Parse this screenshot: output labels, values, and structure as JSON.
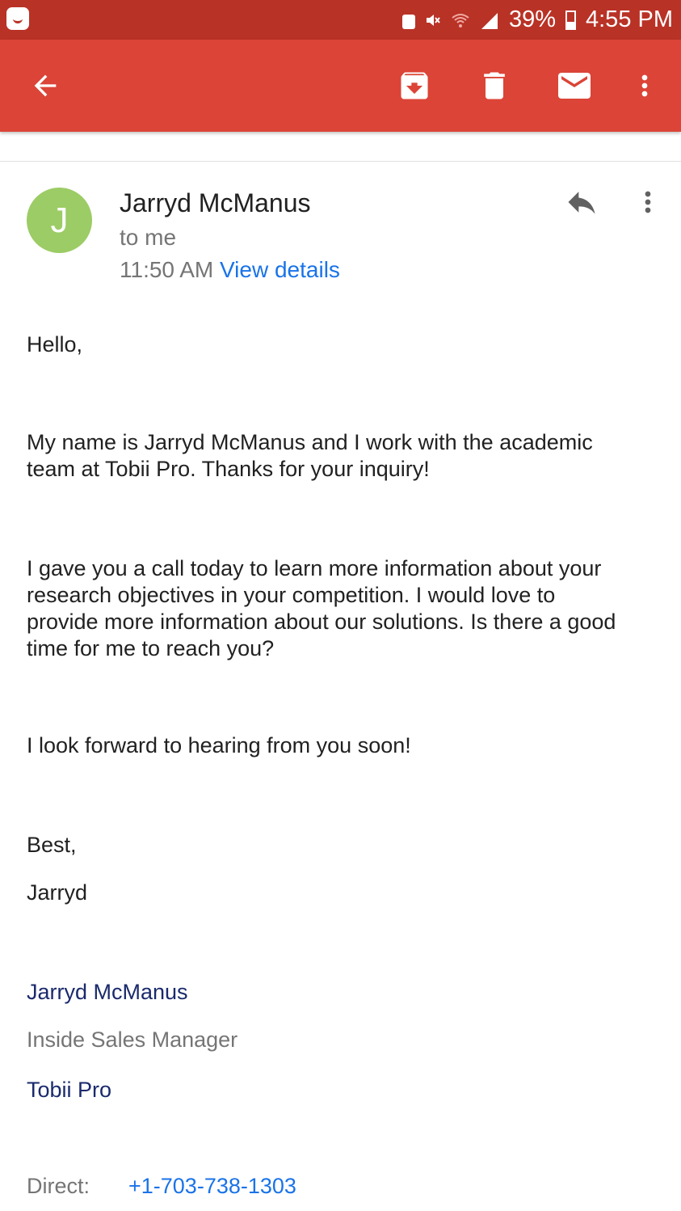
{
  "status_bar": {
    "battery_percent": "39%",
    "battery_level": 0.39,
    "time": "4:55 PM",
    "icons": [
      "notification-app-icon",
      "lock-icon",
      "mute-icon",
      "wifi-icon",
      "signal-icon",
      "battery-icon"
    ]
  },
  "app_bar": {
    "background": "#db4437",
    "actions": [
      "back-icon",
      "archive-icon",
      "delete-icon",
      "mark-unread-icon",
      "more-vert-icon"
    ]
  },
  "message": {
    "avatar_letter": "J",
    "avatar_color": "#9ccc65",
    "sender": "Jarryd McManus",
    "recipient": "to me",
    "time": "11:50 AM",
    "view_details": "View details",
    "body": {
      "greeting": "Hello,",
      "p1_line1": "My name is Jarryd McManus and I work with the academic",
      "p1_line2": "team at Tobii Pro. Thanks for your inquiry!",
      "p2_line1": "I gave you a call today to learn more information about your",
      "p2_line2": "research objectives in your competition. I would love to",
      "p2_line3": "provide more information about our solutions. Is there a good",
      "p2_line4": "time for me to reach you?",
      "p3": "I look forward to hearing from you soon!",
      "closing": "Best,",
      "sign_name": "Jarryd"
    },
    "signature": {
      "name": "Jarryd McManus",
      "title": "Inside Sales Manager",
      "company": "Tobii Pro",
      "direct_label": "Direct:",
      "phone": "+1-703-738-1303"
    }
  }
}
